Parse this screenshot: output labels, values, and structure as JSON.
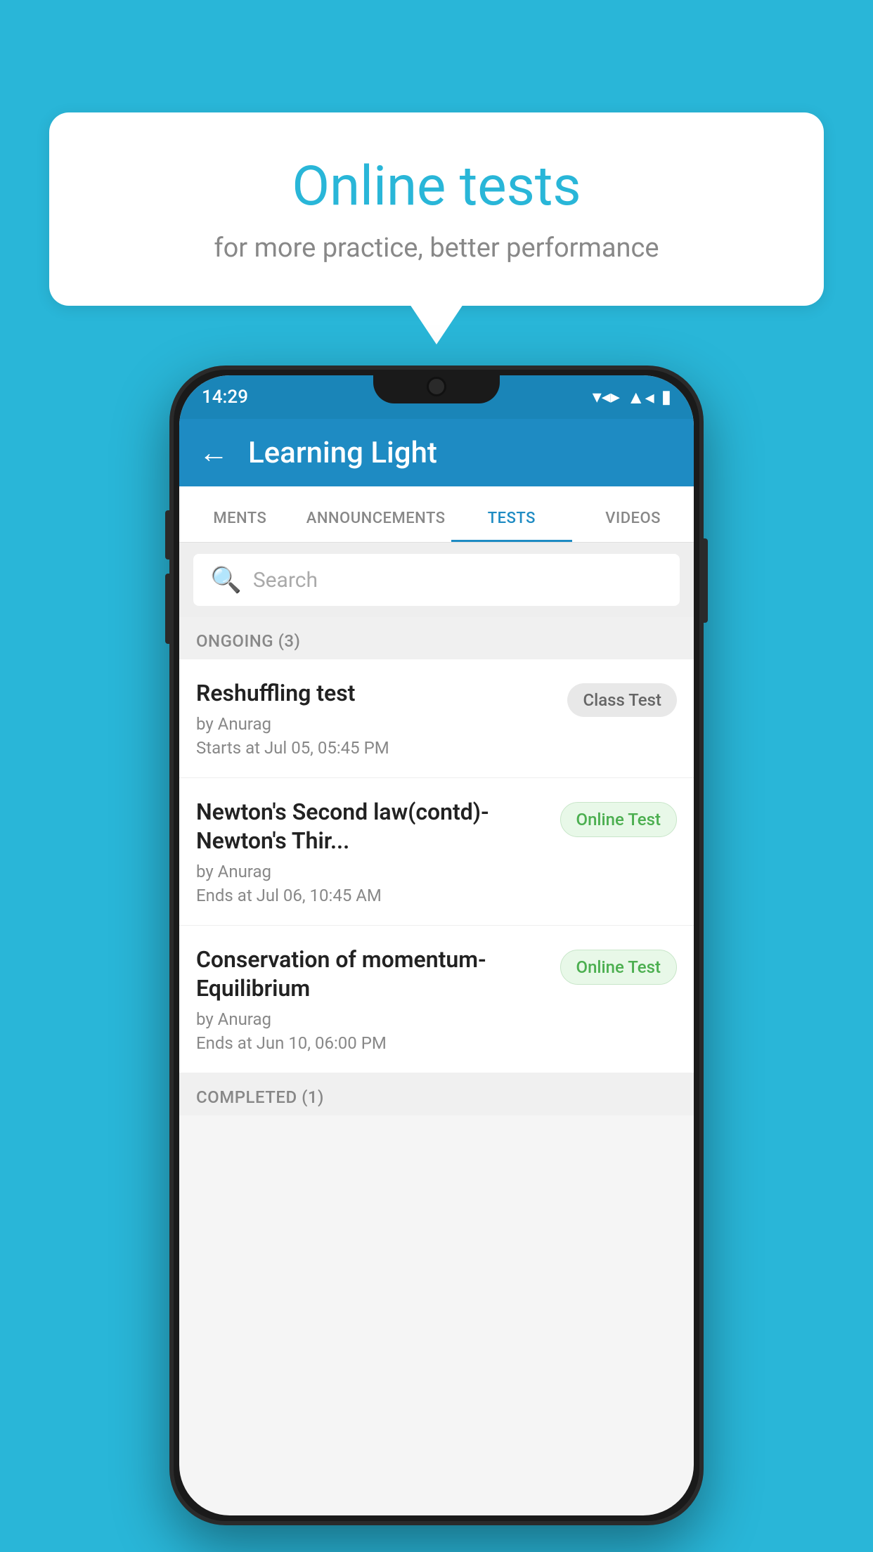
{
  "background_color": "#29b6d8",
  "bubble": {
    "title": "Online tests",
    "subtitle": "for more practice, better performance"
  },
  "phone": {
    "status_bar": {
      "time": "14:29",
      "icons": [
        "wifi",
        "signal",
        "battery"
      ]
    },
    "header": {
      "title": "Learning Light",
      "back_label": "←"
    },
    "tabs": [
      {
        "label": "MENTS",
        "active": false
      },
      {
        "label": "ANNOUNCEMENTS",
        "active": false
      },
      {
        "label": "TESTS",
        "active": true
      },
      {
        "label": "VIDEOS",
        "active": false
      }
    ],
    "search": {
      "placeholder": "Search"
    },
    "sections": [
      {
        "title": "ONGOING (3)",
        "tests": [
          {
            "name": "Reshuffling test",
            "author": "by Anurag",
            "time_label": "Starts at",
            "time": "Jul 05, 05:45 PM",
            "badge": "Class Test",
            "badge_type": "class"
          },
          {
            "name": "Newton's Second law(contd)-Newton's Thir...",
            "author": "by Anurag",
            "time_label": "Ends at",
            "time": "Jul 06, 10:45 AM",
            "badge": "Online Test",
            "badge_type": "online"
          },
          {
            "name": "Conservation of momentum-Equilibrium",
            "author": "by Anurag",
            "time_label": "Ends at",
            "time": "Jun 10, 06:00 PM",
            "badge": "Online Test",
            "badge_type": "online"
          }
        ]
      }
    ],
    "completed_section_title": "COMPLETED (1)"
  }
}
